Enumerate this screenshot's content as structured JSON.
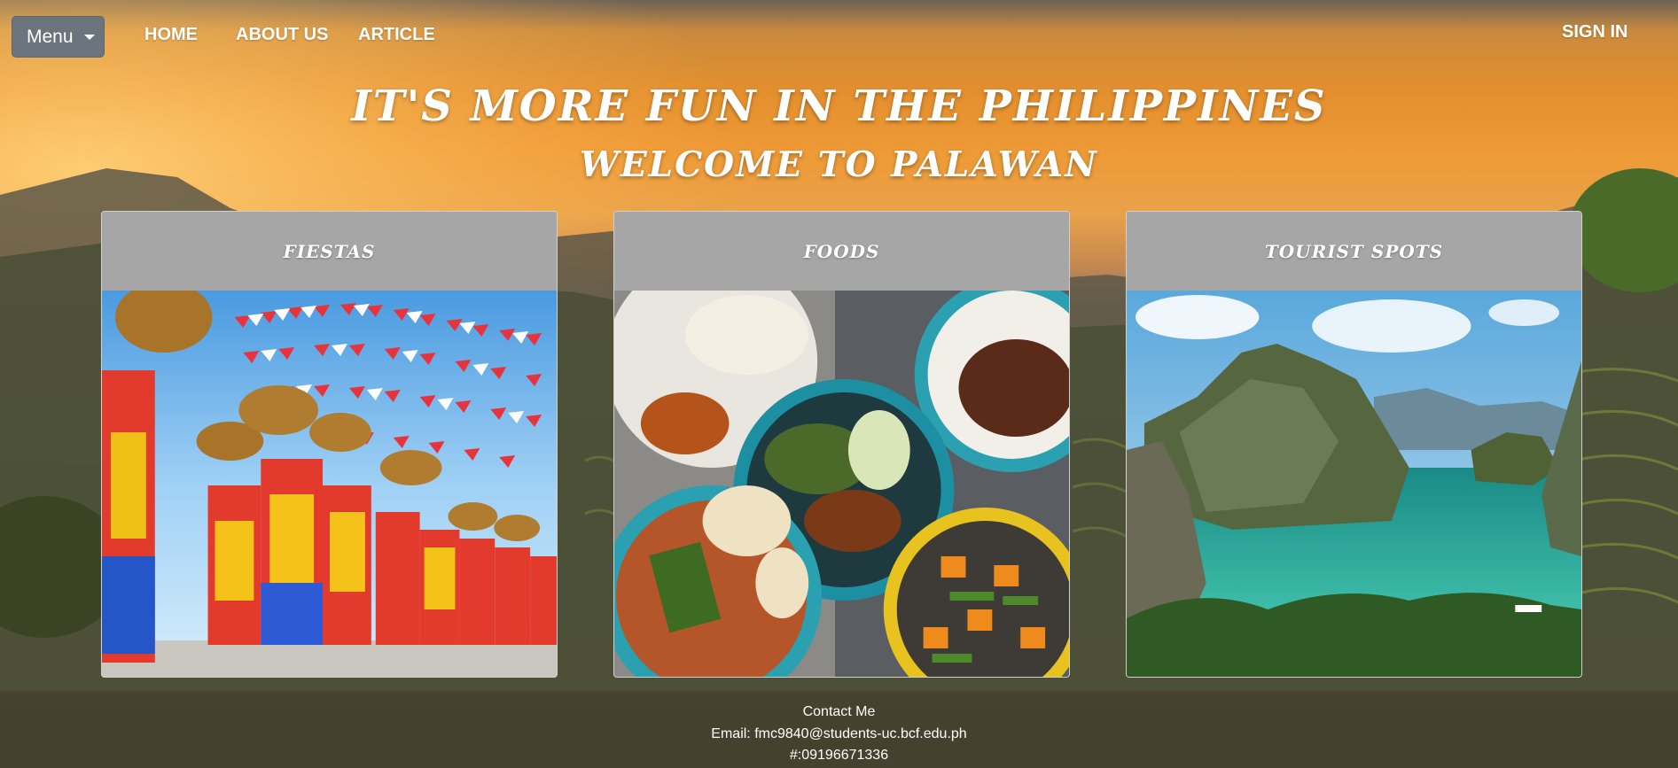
{
  "nav": {
    "menu_label": "Menu",
    "links": [
      "HOME",
      "ABOUT US",
      "ARTICLE"
    ],
    "sign_in": "SIGN IN"
  },
  "hero": {
    "title": "It's more fun in the Philippines",
    "subtitle": "Welcome to Palawan"
  },
  "cards": [
    {
      "title": "Fiestas",
      "image": "festival-dancers-photo"
    },
    {
      "title": "Foods",
      "image": "filipino-dishes-photo"
    },
    {
      "title": "Tourist Spots",
      "image": "lagoon-island-photo"
    }
  ],
  "footer": {
    "heading": "Contact Me",
    "email": "Email: fmc9840@students-uc.bcf.edu.ph",
    "phone": "#:09196671336"
  },
  "colors": {
    "menu_button": "#6c757d",
    "card_header": "#a6a6a6",
    "footer_bg": "#463e2d"
  }
}
